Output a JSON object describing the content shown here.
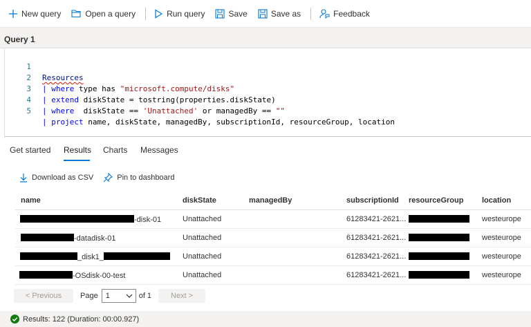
{
  "toolbar": {
    "new_query": "New query",
    "open_query": "Open a query",
    "run_query": "Run query",
    "save": "Save",
    "save_as": "Save as",
    "feedback": "Feedback"
  },
  "query_tab": "Query 1",
  "editor": {
    "line_numbers": [
      "1",
      "2",
      "3",
      "4",
      "5"
    ],
    "line1": "Resources",
    "line2": {
      "pipe": "| ",
      "kw": "where",
      "rest": " type has ",
      "str": "\"microsoft.compute/disks\""
    },
    "line3": {
      "pipe": "| ",
      "kw": "extend",
      "rest": " diskState = tostring(properties.diskState)"
    },
    "line4": {
      "pipe": "| ",
      "kw": "where",
      "rest": "  diskState == ",
      "str1": "'Unattached'",
      "mid": " or managedBy == ",
      "str2": "\"\""
    },
    "line5": {
      "pipe": "| ",
      "kw": "project",
      "rest": " name, diskState, managedBy, subscriptionId, resourceGroup, location"
    }
  },
  "result_tabs": [
    "Get started",
    "Results",
    "Charts",
    "Messages"
  ],
  "active_result_tab": "Results",
  "actions": {
    "download_csv": "Download as CSV",
    "pin": "Pin to dashboard"
  },
  "table": {
    "headers": [
      "name",
      "diskState",
      "managedBy",
      "subscriptionId",
      "resourceGroup",
      "location"
    ],
    "rows": [
      {
        "name_suffix": "-disk-01",
        "diskState": "Unattached",
        "managedBy": "",
        "subscriptionId": "61283421-2621...",
        "location": "westeurope"
      },
      {
        "name_suffix": "-datadisk-01",
        "diskState": "Unattached",
        "managedBy": "",
        "subscriptionId": "61283421-2621...",
        "location": "westeurope"
      },
      {
        "name_mid": "_disk1_",
        "diskState": "Unattached",
        "managedBy": "",
        "subscriptionId": "61283421-2621...",
        "location": "westeurope"
      },
      {
        "name_suffix": "-OSdisk-00-test",
        "diskState": "Unattached",
        "managedBy": "",
        "subscriptionId": "61283421-2621...",
        "location": "westeurope"
      }
    ]
  },
  "pager": {
    "previous": "< Previous",
    "page_label": "Page",
    "page_value": "1",
    "of_label": "of 1",
    "next": "Next >"
  },
  "status": {
    "text": "Results: 122 (Duration: 00:00.927)"
  },
  "colors": {
    "accent": "#0078d4",
    "success": "#107c10"
  }
}
